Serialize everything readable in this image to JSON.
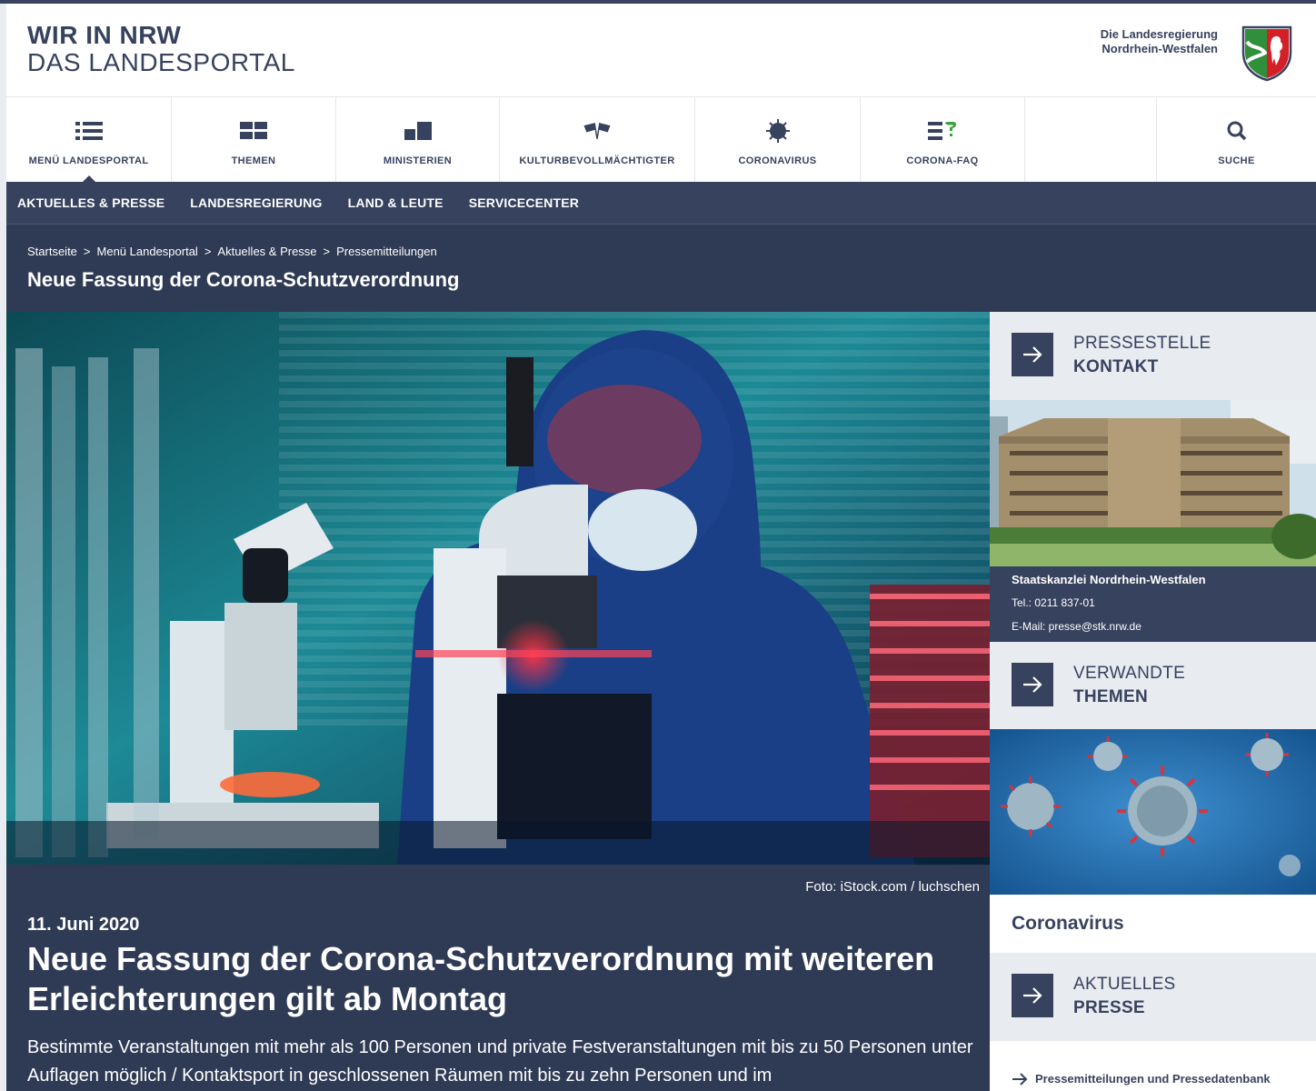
{
  "header": {
    "brand_line1": "WIR IN NRW",
    "brand_line2": "DAS LANDESPORTAL",
    "gov_line1": "Die Landesregierung",
    "gov_line2": "Nordrhein-Westfalen"
  },
  "topnav": {
    "items": [
      {
        "label": "MENÜ LANDESPORTAL",
        "icon": "menu-list-icon"
      },
      {
        "label": "THEMEN",
        "icon": "themes-grid-icon"
      },
      {
        "label": "MINISTERIEN",
        "icon": "ministries-icon"
      },
      {
        "label": "KULTURBEVOLLMÄCHTIGTER",
        "icon": "flags-icon"
      },
      {
        "label": "CORONAVIRUS",
        "icon": "virus-icon"
      },
      {
        "label": "CORONA-FAQ",
        "icon": "faq-icon"
      },
      {
        "label": "SUCHE",
        "icon": "search-icon"
      }
    ]
  },
  "subnav": {
    "items": [
      "AKTUELLES & PRESSE",
      "LANDESREGIERUNG",
      "LAND & LEUTE",
      "SERVICECENTER"
    ]
  },
  "breadcrumb": {
    "items": [
      "Startseite",
      "Menü Landesportal",
      "Aktuelles & Presse",
      "Pressemitteilungen"
    ],
    "separator": ">",
    "title": "Neue Fassung der Corona-Schutzverordnung"
  },
  "article": {
    "photo_credit": "Foto: iStock.com / luchschen",
    "date": "11. Juni 2020",
    "title": "Neue Fassung der Corona-Schutzverordnung mit weiteren Erleichterungen gilt ab Montag",
    "lead": "Bestimmte Veranstaltungen mit mehr als 100 Personen und private Festveranstaltungen mit bis zu 50 Personen unter Auflagen möglich / Kontaktsport in geschlossenen Räumen mit bis zu zehn Personen und im"
  },
  "sidebar": {
    "press": {
      "line1": "PRESSESTELLE",
      "line2": "KONTAKT"
    },
    "contact": {
      "name": "Staatskanzlei Nordrhein-Westfalen",
      "phone": "Tel.: 0211 837-01",
      "email": "E-Mail: presse@stk.nrw.de"
    },
    "related": {
      "line1": "VERWANDTE",
      "line2": "THEMEN"
    },
    "topic": "Coronavirus",
    "news": {
      "line1": "AKTUELLES",
      "line2": "PRESSE"
    },
    "link": "Pressemitteilungen und Pressedatenbank"
  },
  "colors": {
    "navy": "#37425e",
    "navy_dark": "#2f3a55",
    "light_panel": "#e8ebf0",
    "teal": "#1d8a96",
    "faq_green": "#3aa23a"
  }
}
